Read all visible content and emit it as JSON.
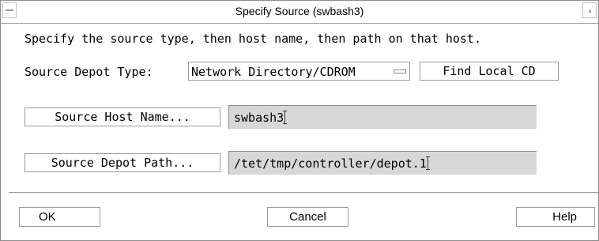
{
  "window": {
    "title": "Specify Source (swbash3)"
  },
  "dialog": {
    "instructions": "Specify the source type, then host name, then path on that host.",
    "depot_type_label": "Source Depot Type:",
    "depot_type_value": "Network Directory/CDROM",
    "find_local_cd_label": "Find Local CD",
    "host_button_label": "Source Host Name...",
    "host_value": "swbash3",
    "path_button_label": "Source Depot Path...",
    "path_value": "/tet/tmp/controller/depot.1"
  },
  "footer": {
    "ok_label": "OK",
    "cancel_label": "Cancel",
    "help_label": "Help"
  },
  "icons": {
    "window_menu": "window-menu-icon",
    "minimize": "minimize-icon",
    "option_menu": "option-menu-indicator-icon",
    "text_cursor": "i-beam-cursor-icon"
  }
}
